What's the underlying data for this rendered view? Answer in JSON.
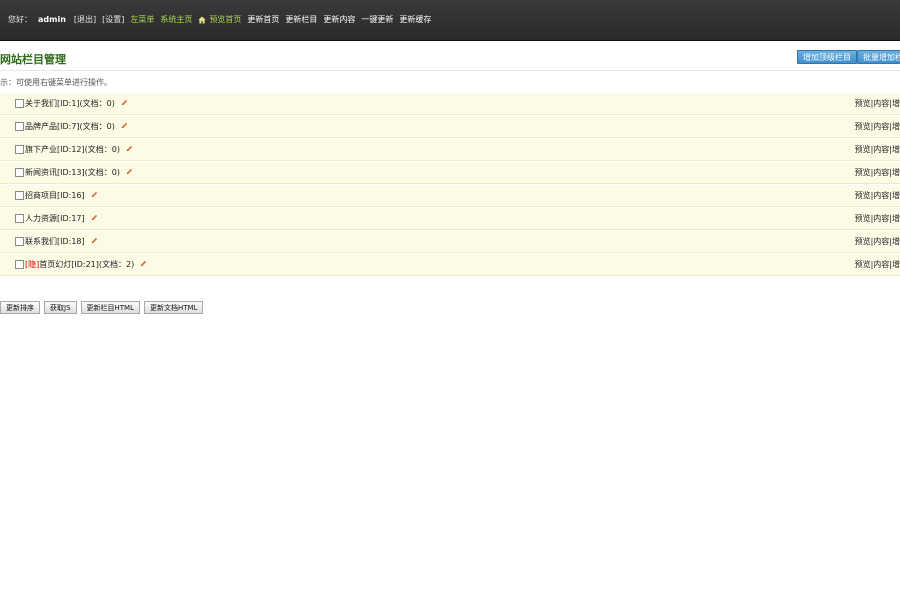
{
  "header": {
    "greeting": "您好：",
    "username": "admin",
    "logout": "[退出]",
    "settings": "[设置]",
    "left_menu": "左菜单",
    "system_home": "系统主页",
    "preview_home": "预览首页",
    "update_home": "更新首页",
    "update_column": "更新栏目",
    "update_content": "更新内容",
    "one_click_update": "一键更新",
    "update_cache": "更新缓存"
  },
  "page": {
    "title": "网站栏目管理",
    "add_top_column": "增加顶级栏目",
    "batch_add_column": "批量增加栏目",
    "hint": "示：可使用右键菜单进行操作。"
  },
  "tree": {
    "rows": [
      {
        "tag": "",
        "label": "关于我们[ID:1](文档：0)",
        "ops": "预览|内容|增"
      },
      {
        "tag": "",
        "label": "品牌产品[ID:7](文档：0)",
        "ops": "预览|内容|增"
      },
      {
        "tag": "",
        "label": "旗下产业[ID:12](文档：0)",
        "ops": "预览|内容|增"
      },
      {
        "tag": "",
        "label": "新闻资讯[ID:13](文档：0)",
        "ops": "预览|内容|增"
      },
      {
        "tag": "",
        "label": "招商项目[ID:16]",
        "ops": "预览|内容|增"
      },
      {
        "tag": "",
        "label": "人力资源[ID:17]",
        "ops": "预览|内容|增"
      },
      {
        "tag": "",
        "label": "联系我们[ID:18]",
        "ops": "预览|内容|增"
      },
      {
        "tag": "[隐]",
        "label": "首页幻灯[ID:21](文档：2)",
        "ops": "预览|内容|增"
      }
    ]
  },
  "actions": {
    "update_sort": "更新排序",
    "get_js": "获取JS",
    "update_column_html": "更新栏目HTML",
    "update_doc_html": "更新文档HTML"
  },
  "icons": {
    "home": "home-icon",
    "edit": "pencil-icon"
  },
  "colors": {
    "topbar": "#2f2f2f",
    "title_green": "#2f6b19",
    "nav_green": "#a8d84e",
    "button_blue": "#4a99d6",
    "row_bg": "#fcfbe6",
    "hidden_tag": "#dd0000"
  }
}
